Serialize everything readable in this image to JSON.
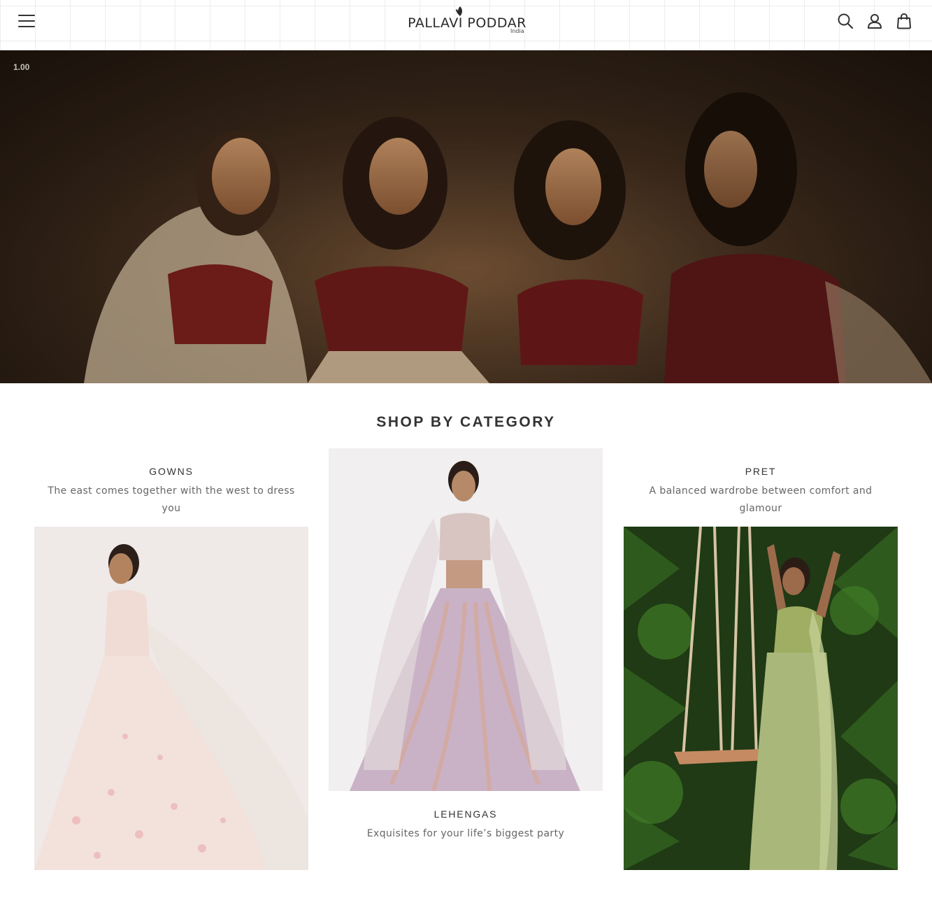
{
  "header": {
    "menu_icon": "hamburger-menu-icon",
    "logo_text": "PALLAVI PODDAR",
    "logo_sub": "India",
    "icons": [
      "search-icon",
      "account-icon",
      "cart-icon"
    ]
  },
  "hero": {
    "zoom_label": "1.00"
  },
  "category_section": {
    "title": "SHOP BY CATEGORY",
    "items": [
      {
        "label": "GOWNS",
        "description": "The east comes together with the west to dress you"
      },
      {
        "label": "LEHENGAS",
        "description": "Exquisites for your life’s biggest party"
      },
      {
        "label": "PRET",
        "description": "A balanced wardrobe between comfort and glamour"
      }
    ]
  },
  "colors": {
    "text_dark": "#333333",
    "text_muted": "#666666",
    "hero_tone": "#3c2a1c"
  }
}
